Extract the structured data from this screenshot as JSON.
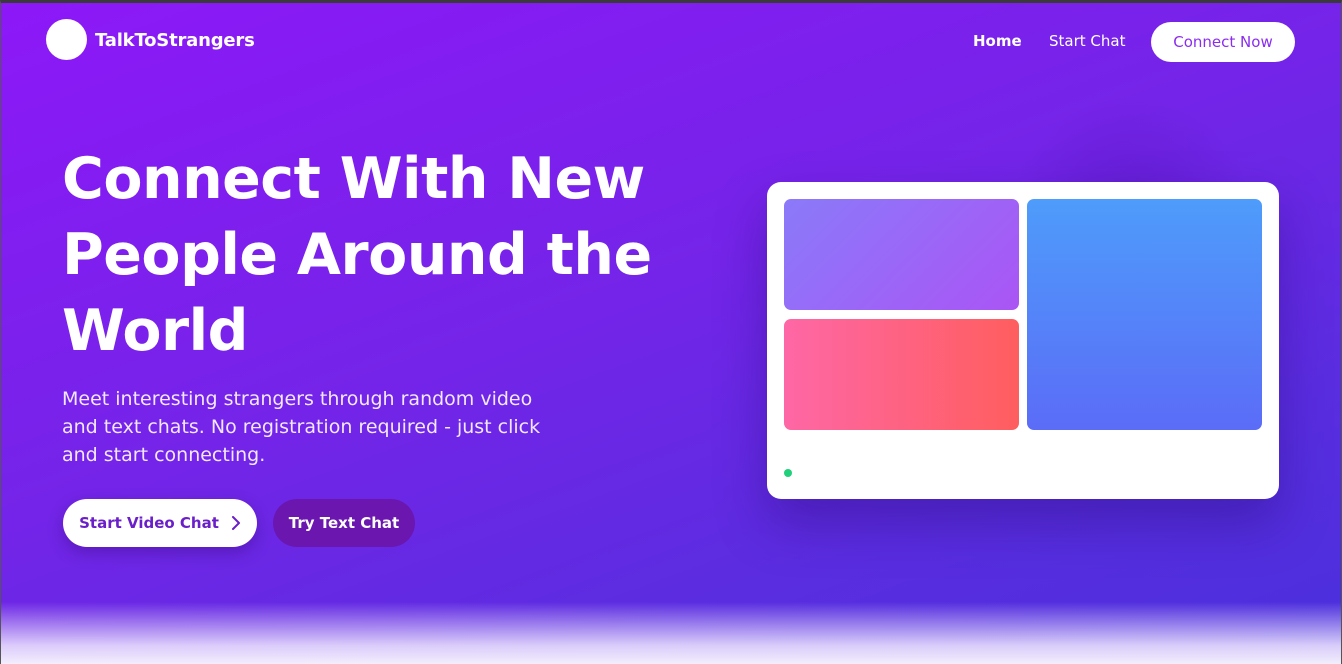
{
  "brand": {
    "name": "TalkToStrangers"
  },
  "nav": {
    "items": [
      {
        "label": "Home"
      },
      {
        "label": "Start Chat"
      }
    ],
    "cta_label": "Connect Now"
  },
  "hero": {
    "title": "Connect With New People Around the World",
    "subtitle": "Meet interesting strangers through random video and text chats. No registration required - just click and start connecting.",
    "primary_button": {
      "label": "Start Video Chat",
      "icon": "chevron-right-icon"
    },
    "secondary_button": {
      "label": "Try Text Chat"
    }
  },
  "mockup": {
    "status": "online",
    "tiles": [
      "video-tile-top-left",
      "video-tile-bottom-left",
      "video-tile-right"
    ]
  },
  "colors": {
    "brand_purple": "#8d18f8",
    "accent_violet": "#6b16ae",
    "online_green": "#21d07a"
  }
}
